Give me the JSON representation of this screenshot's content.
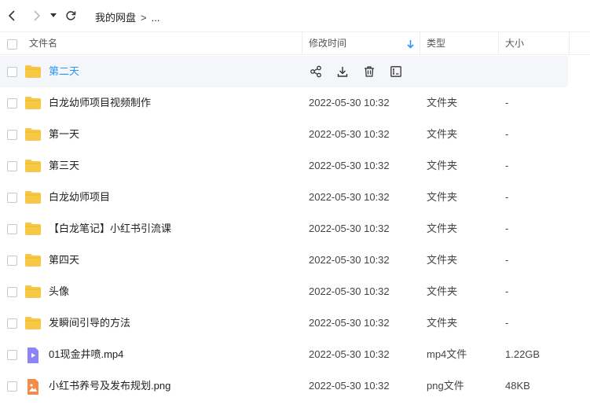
{
  "breadcrumb": {
    "root": "我的网盘",
    "separator": ">",
    "more": "..."
  },
  "columns": {
    "name": "文件名",
    "modified": "修改时间",
    "type": "类型",
    "size": "大小"
  },
  "sort": {
    "column": "modified",
    "direction": "desc",
    "icon": "arrow-down-icon",
    "color": "#2a97f5"
  },
  "colors": {
    "folder": "#f7c844",
    "video": "#8b83f7",
    "image": "#f58b4a",
    "accent": "#2a97f5"
  },
  "hover_actions": [
    "share-icon",
    "download-icon",
    "delete-icon",
    "rename-icon"
  ],
  "files": [
    {
      "name": "第二天",
      "icon": "folder-icon",
      "modified": "",
      "type": "",
      "size": "",
      "hover": true
    },
    {
      "name": "白龙幼师项目视频制作",
      "icon": "folder-icon",
      "modified": "2022-05-30 10:32",
      "type": "文件夹",
      "size": "-"
    },
    {
      "name": "第一天",
      "icon": "folder-icon",
      "modified": "2022-05-30 10:32",
      "type": "文件夹",
      "size": "-"
    },
    {
      "name": "第三天",
      "icon": "folder-icon",
      "modified": "2022-05-30 10:32",
      "type": "文件夹",
      "size": "-"
    },
    {
      "name": "白龙幼师项目",
      "icon": "folder-icon",
      "modified": "2022-05-30 10:32",
      "type": "文件夹",
      "size": "-"
    },
    {
      "name": "【白龙笔记】小红书引流课",
      "icon": "folder-icon",
      "modified": "2022-05-30 10:32",
      "type": "文件夹",
      "size": "-"
    },
    {
      "name": "第四天",
      "icon": "folder-icon",
      "modified": "2022-05-30 10:32",
      "type": "文件夹",
      "size": "-"
    },
    {
      "name": "头像",
      "icon": "folder-icon",
      "modified": "2022-05-30 10:32",
      "type": "文件夹",
      "size": "-"
    },
    {
      "name": "发瞬间引导的方法",
      "icon": "folder-icon",
      "modified": "2022-05-30 10:32",
      "type": "文件夹",
      "size": "-"
    },
    {
      "name": "01现金井喷.mp4",
      "icon": "video-file-icon",
      "modified": "2022-05-30 10:32",
      "type": "mp4文件",
      "size": "1.22GB"
    },
    {
      "name": "小红书养号及发布规划.png",
      "icon": "image-file-icon",
      "modified": "2022-05-30 10:32",
      "type": "png文件",
      "size": "48KB"
    }
  ]
}
